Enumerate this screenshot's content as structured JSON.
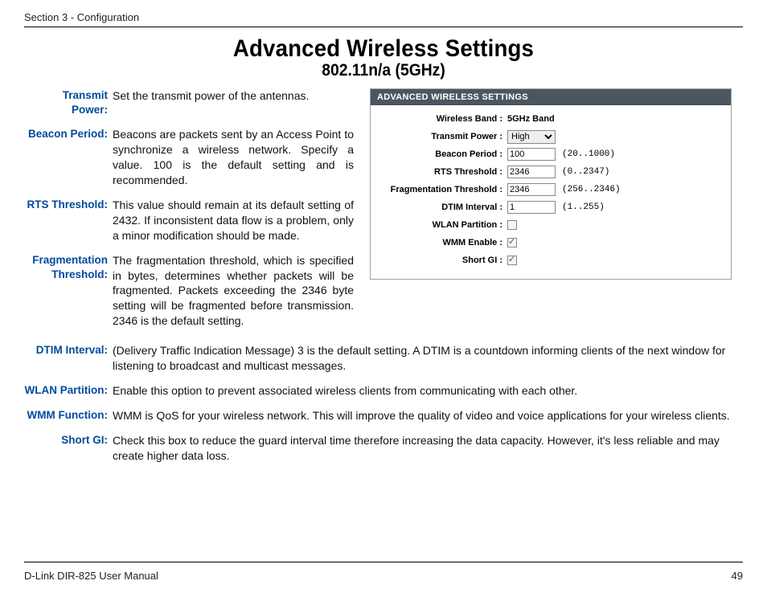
{
  "header": {
    "section": "Section 3 - Configuration"
  },
  "title": "Advanced Wireless Settings",
  "subtitle": "802.11n/a (5GHz)",
  "defs": {
    "transmit_power": {
      "label": "Transmit Power:",
      "text": "Set the transmit power of the antennas."
    },
    "beacon_period": {
      "label": "Beacon Period:",
      "text": "Beacons are packets sent by an Access Point to synchronize a wireless network. Specify a value. 100 is the default setting and is recommended."
    },
    "rts_threshold": {
      "label": "RTS Threshold:",
      "text": "This value should remain at its default setting of 2432. If inconsistent data flow is a problem, only a minor modification should be made."
    },
    "fragmentation": {
      "label": "Fragmentation Threshold:",
      "text": "The fragmentation threshold, which is specified in bytes, determines whether packets will be fragmented. Packets exceeding the 2346 byte setting will be fragmented before transmission. 2346 is the default setting."
    },
    "dtim_interval": {
      "label": "DTIM Interval:",
      "text": "(Delivery Traffic Indication Message) 3 is the default setting. A DTIM is a countdown informing clients of the next window for listening to broadcast and multicast messages."
    },
    "wlan_partition": {
      "label": "WLAN Partition:",
      "text": "Enable this option to prevent associated wireless clients from communicating with each other."
    },
    "wmm_function": {
      "label": "WMM Function:",
      "text": "WMM is QoS for your wireless network. This will improve the quality of video and voice applications for your wireless clients."
    },
    "short_gi": {
      "label": "Short GI:",
      "text": "Check this box to reduce the guard interval time therefore increasing the data capacity. However, it's less reliable and may create higher data loss."
    }
  },
  "panel": {
    "title": "ADVANCED WIRELESS SETTINGS",
    "rows": {
      "wireless_band": {
        "label": "Wireless Band :",
        "value": "5GHz Band"
      },
      "transmit_power": {
        "label": "Transmit Power :",
        "value": "High"
      },
      "beacon_period": {
        "label": "Beacon Period :",
        "value": "100",
        "range": "(20..1000)"
      },
      "rts_threshold": {
        "label": "RTS Threshold :",
        "value": "2346",
        "range": "(0..2347)"
      },
      "fragmentation": {
        "label": "Fragmentation Threshold :",
        "value": "2346",
        "range": "(256..2346)"
      },
      "dtim_interval": {
        "label": "DTIM Interval :",
        "value": "1",
        "range": "(1..255)"
      },
      "wlan_partition": {
        "label": "WLAN Partition :"
      },
      "wmm_enable": {
        "label": "WMM Enable :"
      },
      "short_gi": {
        "label": "Short GI :"
      }
    }
  },
  "footer": {
    "left": "D-Link DIR-825 User Manual",
    "page": "49"
  }
}
